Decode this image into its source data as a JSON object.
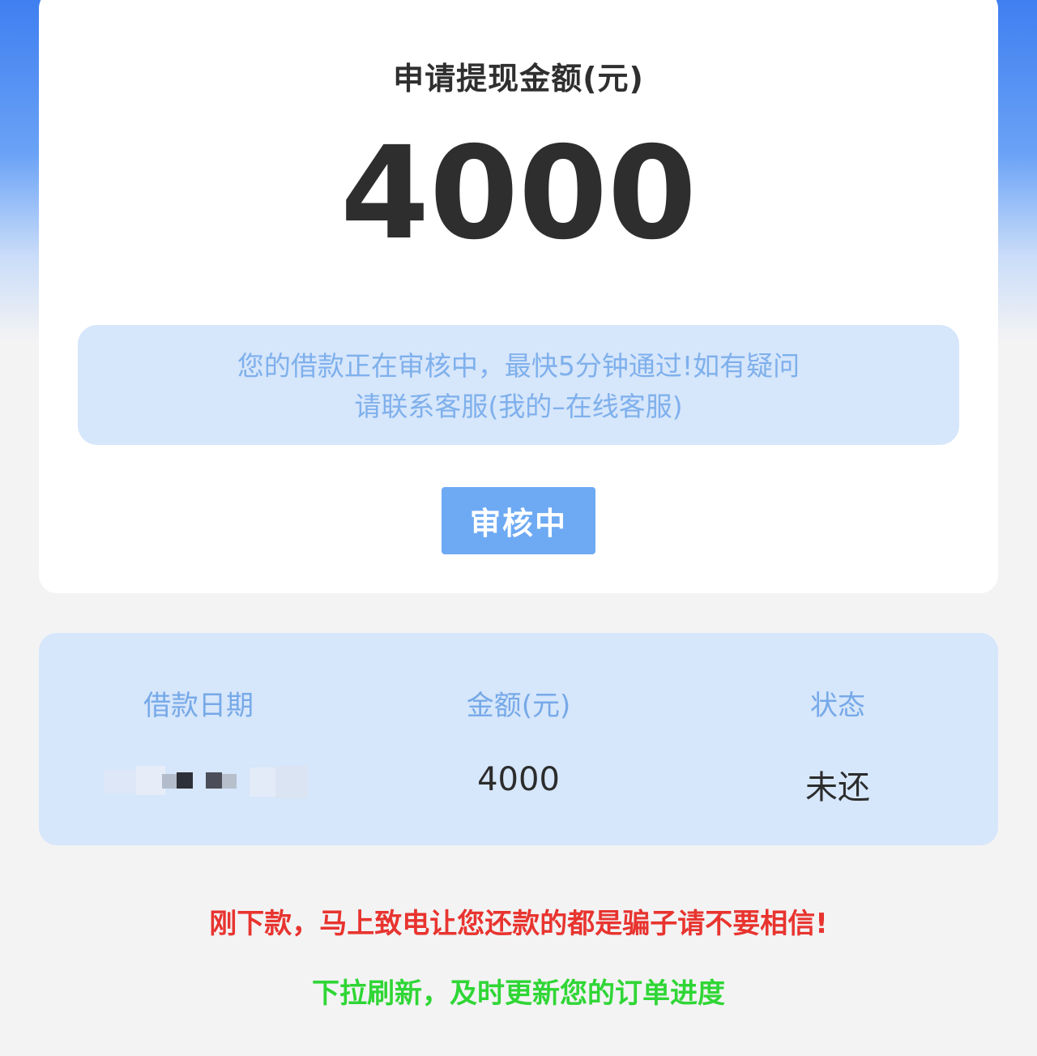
{
  "withdraw": {
    "title": "申请提现金额(元)",
    "amount": "4000",
    "notice_line1": "您的借款正在审核中，最快5分钟通过!如有疑问",
    "notice_line2": "请联系客服(我的–在线客服)",
    "status_button": "审核中"
  },
  "loan_table": {
    "headers": [
      "借款日期",
      "金额(元)",
      "状态"
    ],
    "rows": [
      {
        "amount": "4000",
        "status": "未还"
      }
    ]
  },
  "footer": {
    "warning": "刚下款，马上致电让您还款的都是骗子请不要相信!",
    "refresh_hint": "下拉刷新，及时更新您的订单进度"
  },
  "colors": {
    "accent": "#6eaaf3",
    "panel": "#d6e6fb",
    "warning": "#e8342f",
    "hint": "#2fd635"
  }
}
